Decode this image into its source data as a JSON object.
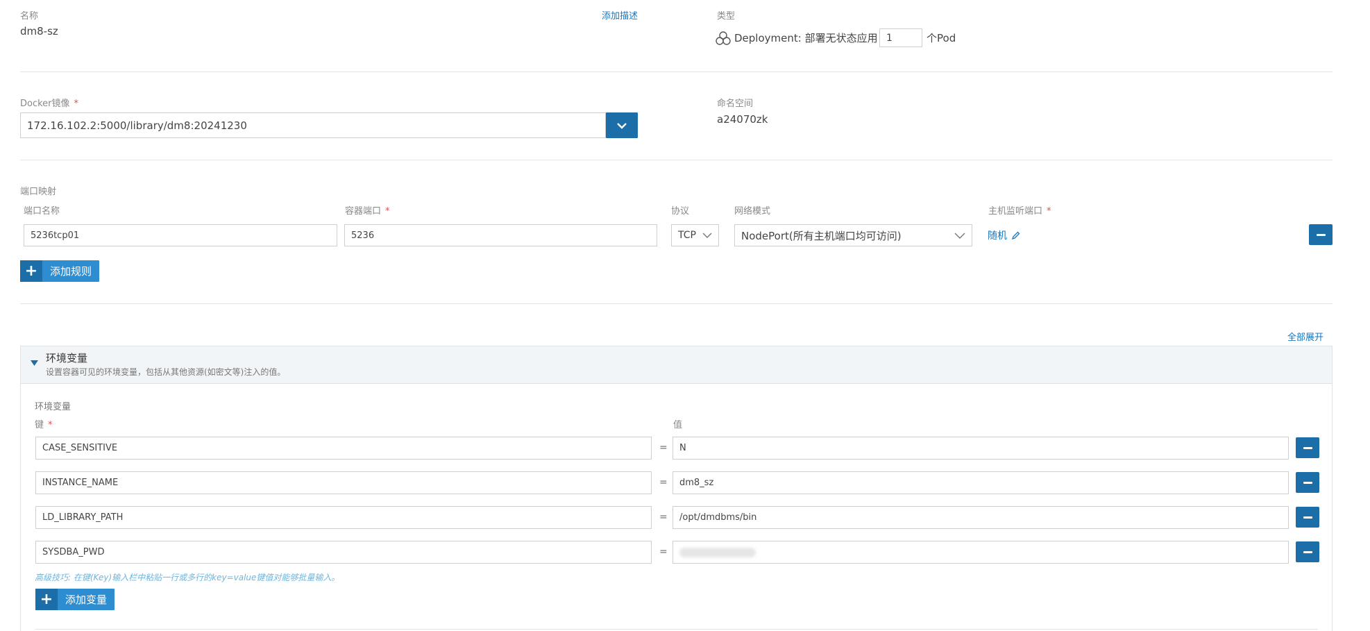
{
  "basic": {
    "name_label": "名称",
    "name_value": "dm8-sz",
    "add_desc": "添加描述",
    "type_label": "类型",
    "type_text": "Deployment: 部署无状态应用",
    "pod_count": "1",
    "pod_suffix": "个Pod"
  },
  "image": {
    "label": "Docker镜像",
    "required": "*",
    "value": "172.16.102.2:5000/library/dm8:20241230",
    "namespace_label": "命名空间",
    "namespace_value": "a24070zk"
  },
  "ports": {
    "section_label": "端口映射",
    "col_name": "端口名称",
    "col_container_port": "容器端口",
    "col_protocol": "协议",
    "col_network": "网络模式",
    "col_host_port": "主机监听端口",
    "required": "*",
    "rows": [
      {
        "name": "5236tcp01",
        "container_port": "5236",
        "protocol": "TCP",
        "network_mode": "NodePort(所有主机端口均可访问)",
        "host_port": "随机"
      }
    ],
    "add_rule": "添加规则"
  },
  "env": {
    "expand_all": "全部展开",
    "title": "环境变量",
    "subtitle": "设置容器可见的环境变量，包括从其他资源(如密文等)注入的值。",
    "inner_label": "环境变量",
    "key_label": "键",
    "value_label": "值",
    "required": "*",
    "equals": "=",
    "rows": [
      {
        "key": "CASE_SENSITIVE",
        "value": "N"
      },
      {
        "key": "INSTANCE_NAME",
        "value": "dm8_sz"
      },
      {
        "key": "LD_LIBRARY_PATH",
        "value": "/opt/dmdbms/bin"
      },
      {
        "key": "SYSDBA_PWD",
        "value": ""
      }
    ],
    "tip": "高级技巧: 在键(Key)输入栏中粘贴一行或多行的key=value键值对能够批量输入。",
    "add_var": "添加变量"
  },
  "colors": {
    "accent": "#1b6ea8",
    "link": "#1b75bb",
    "required": "#d9534f",
    "panel_header": "#f2f5f7"
  }
}
